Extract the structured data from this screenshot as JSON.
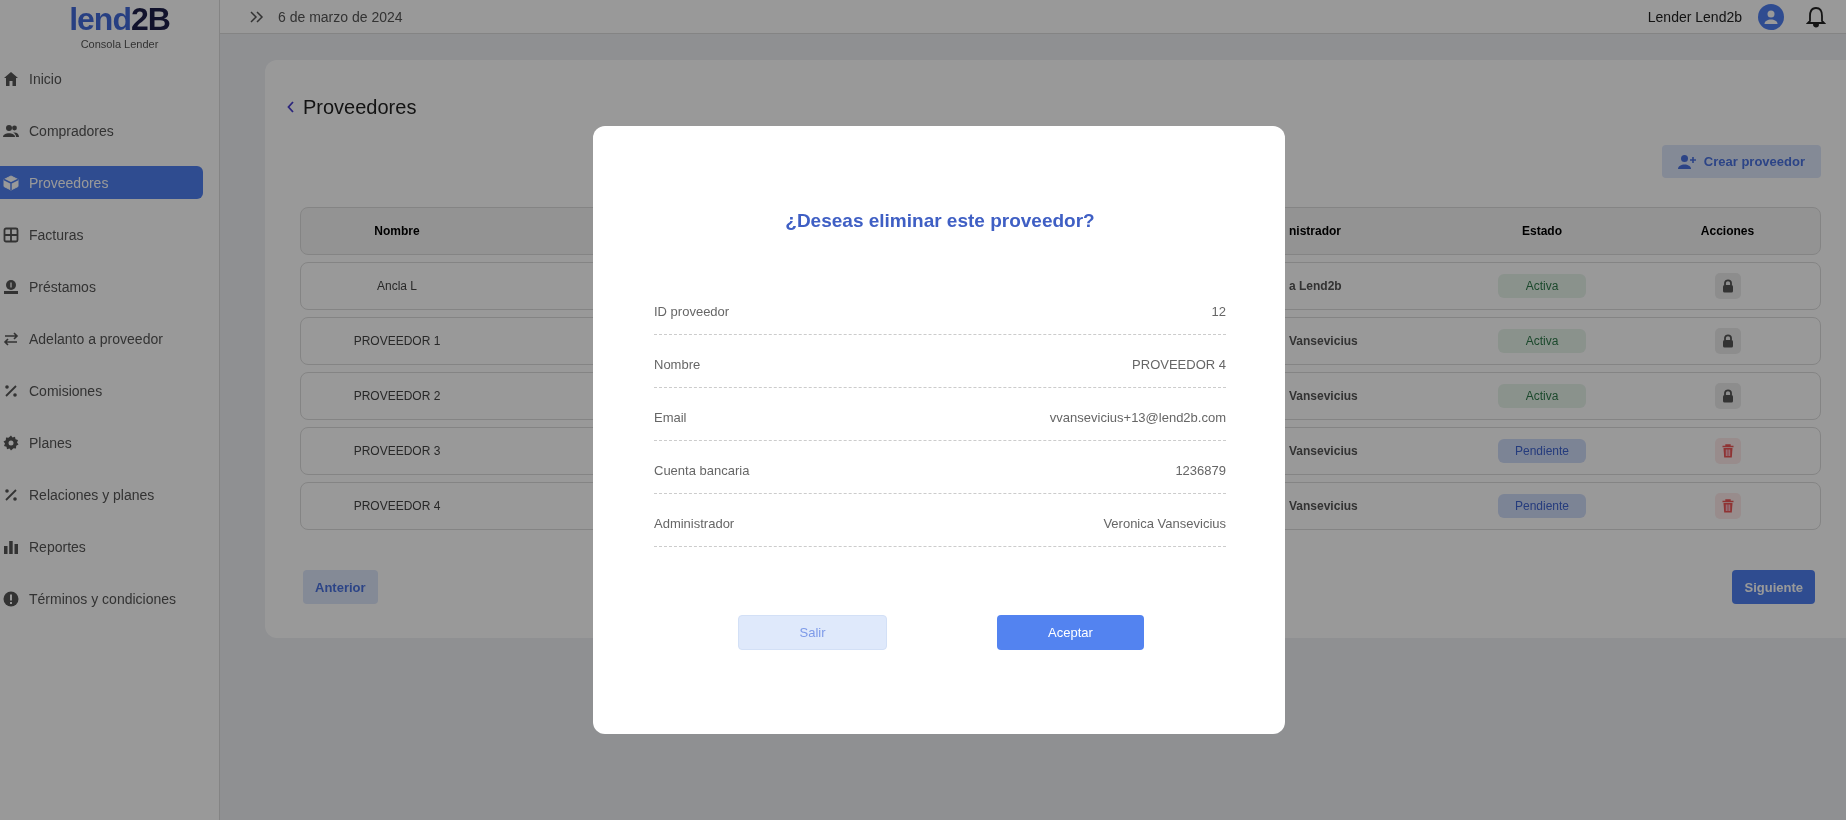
{
  "logo": {
    "text": "lend2B",
    "subtitle": "Consola Lender"
  },
  "sidebar": {
    "items": [
      {
        "label": "Inicio",
        "selected": false
      },
      {
        "label": "Compradores",
        "selected": false
      },
      {
        "label": "Proveedores",
        "selected": true
      },
      {
        "label": "Facturas",
        "selected": false
      },
      {
        "label": "Préstamos",
        "selected": false
      },
      {
        "label": "Adelanto a proveedor",
        "selected": false
      },
      {
        "label": "Comisiones",
        "selected": false
      },
      {
        "label": "Planes",
        "selected": false
      },
      {
        "label": "Relaciones y planes",
        "selected": false
      },
      {
        "label": "Reportes",
        "selected": false
      },
      {
        "label": "Términos y condiciones",
        "selected": false
      }
    ]
  },
  "topbar": {
    "date": "6 de marzo de 2024",
    "user": "Lender Lend2b"
  },
  "page": {
    "title": "Proveedores",
    "create_button": "Crear proveedor",
    "table": {
      "columns": [
        "Nombre",
        "nistrador",
        "Estado",
        "Acciones"
      ],
      "rows": [
        {
          "name": "Ancla L",
          "admin": "a Lend2b",
          "status": {
            "label": "Activa",
            "kind": "active"
          },
          "action": {
            "kind": "lock"
          }
        },
        {
          "name": "PROVEEDOR 1",
          "admin": "Vansevicius",
          "status": {
            "label": "Activa",
            "kind": "active"
          },
          "action": {
            "kind": "lock"
          }
        },
        {
          "name": "PROVEEDOR 2",
          "admin": "Vansevicius",
          "status": {
            "label": "Activa",
            "kind": "active"
          },
          "action": {
            "kind": "lock"
          }
        },
        {
          "name": "PROVEEDOR 3",
          "admin": "Vansevicius",
          "status": {
            "label": "Pendiente",
            "kind": "pending"
          },
          "action": {
            "kind": "delete"
          }
        },
        {
          "name": "PROVEEDOR 4",
          "admin": "Vansevicius",
          "status": {
            "label": "Pendiente",
            "kind": "pending"
          },
          "action": {
            "kind": "delete"
          }
        }
      ]
    },
    "prev_button": "Anterior",
    "next_button": "Siguiente"
  },
  "dialog": {
    "title": "¿Deseas eliminar este proveedor?",
    "fields": [
      {
        "label": "ID proveedor",
        "value": "12"
      },
      {
        "label": "Nombre",
        "value": "PROVEEDOR 4"
      },
      {
        "label": "Email",
        "value": "vvansevicius+13@lend2b.com"
      },
      {
        "label": "Cuenta bancaria",
        "value": "1236879"
      },
      {
        "label": "Administrador",
        "value": "Veronica Vansevicius"
      }
    ],
    "buttons": [
      {
        "label": "Salir",
        "kind": "secondary"
      },
      {
        "label": "Aceptar",
        "kind": "primary"
      }
    ]
  }
}
